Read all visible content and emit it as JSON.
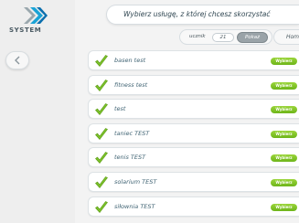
{
  "brand": {
    "logo": "ck-system-logo",
    "name": "SYSTEM"
  },
  "header": {
    "title": "Wybierz usługę, z której chcesz skorzystać"
  },
  "filter": {
    "label": "ucznik",
    "count": "21",
    "button": "Pokaż",
    "extra": "Hom"
  },
  "colors": {
    "accent_green": "#7bc12a",
    "text": "#3e6272"
  },
  "services": [
    {
      "label": "basen test",
      "action": "Wybierz"
    },
    {
      "label": "fitness test",
      "action": "Wybierz"
    },
    {
      "label": "test",
      "action": "Wybierz"
    },
    {
      "label": "taniec TEST",
      "action": "Wybierz"
    },
    {
      "label": "tenis TEST",
      "action": "Wybierz"
    },
    {
      "label": "solarium TEST",
      "action": "Wybierz"
    },
    {
      "label": "siłownia TEST",
      "action": "Wybierz"
    }
  ]
}
